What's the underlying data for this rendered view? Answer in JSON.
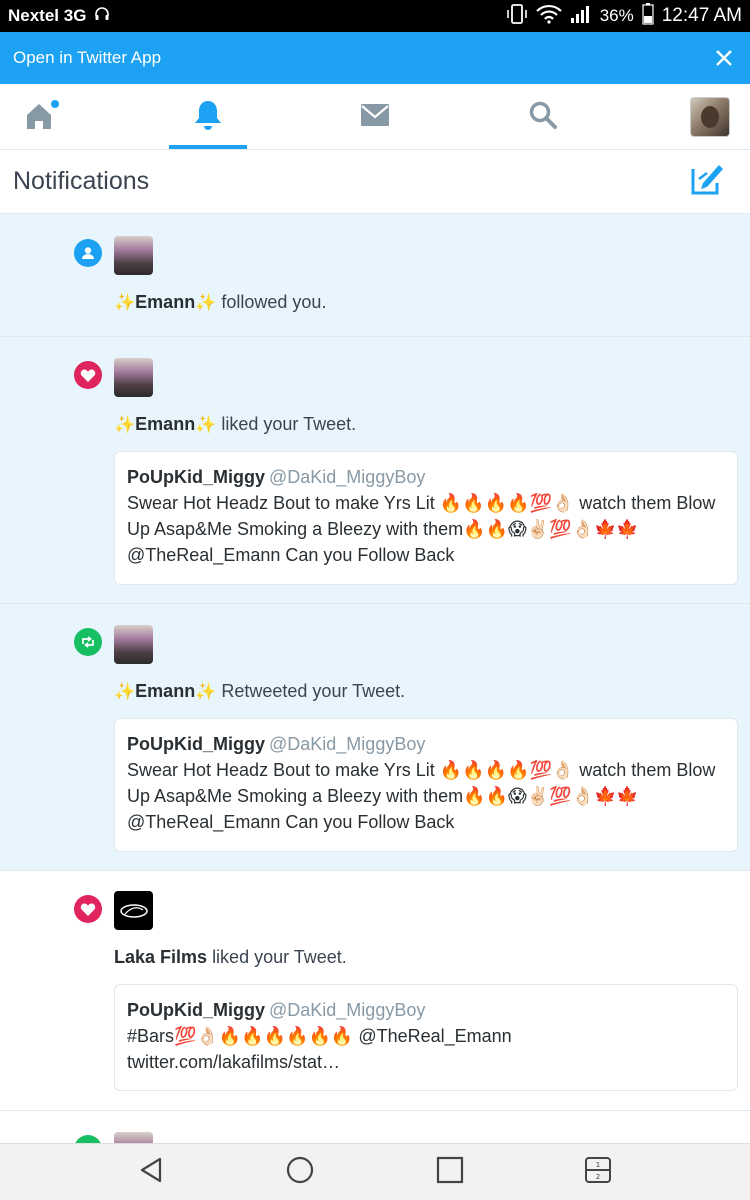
{
  "status_bar": {
    "carrier": "Nextel 3G",
    "battery": "36%",
    "time": "12:47 AM"
  },
  "banner": {
    "label": "Open in Twitter App"
  },
  "tabs": [
    {
      "name": "home",
      "active": false
    },
    {
      "name": "notifications",
      "active": true
    },
    {
      "name": "messages",
      "active": false
    },
    {
      "name": "search",
      "active": false
    },
    {
      "name": "profile",
      "active": false
    }
  ],
  "header": {
    "title": "Notifications"
  },
  "notifications": [
    {
      "type": "follow",
      "actor": "Emann",
      "action": "followed you."
    },
    {
      "type": "like",
      "actor": "Emann",
      "action": "liked your Tweet.",
      "tweet": {
        "author": "PoUpKid_Miggy",
        "handle": "@DaKid_MiggyBoy",
        "text": "Swear Hot Headz Bout to make Yrs Lit 🔥🔥🔥🔥💯👌🏻 watch them Blow Up Asap&Me Smoking a Bleezy with them🔥🔥😱✌🏻💯👌🏻🍁🍁 @TheReal_Emann Can you Follow Back"
      }
    },
    {
      "type": "retweet",
      "actor": "Emann",
      "action": "Retweeted your Tweet.",
      "tweet": {
        "author": "PoUpKid_Miggy",
        "handle": "@DaKid_MiggyBoy",
        "text": "Swear Hot Headz Bout to make Yrs Lit 🔥🔥🔥🔥💯👌🏻 watch them Blow Up Asap&Me Smoking a Bleezy with them🔥🔥😱✌🏻💯👌🏻🍁🍁 @TheReal_Emann Can you Follow Back"
      }
    },
    {
      "type": "like",
      "actor": "Laka Films",
      "action": "liked your Tweet.",
      "tweet": {
        "author": "PoUpKid_Miggy",
        "handle": "@DaKid_MiggyBoy",
        "text": "#Bars💯👌🏻🔥🔥🔥🔥🔥🔥 @TheReal_Emann twitter.com/lakafilms/stat…"
      }
    }
  ],
  "colors": {
    "accent": "#1da1f2",
    "like": "#e0245e",
    "retweet": "#17bf63",
    "unread_bg": "#e8f5fd"
  },
  "icons": {
    "follow": "person-icon",
    "like": "heart-icon",
    "retweet": "retweet-icon"
  }
}
